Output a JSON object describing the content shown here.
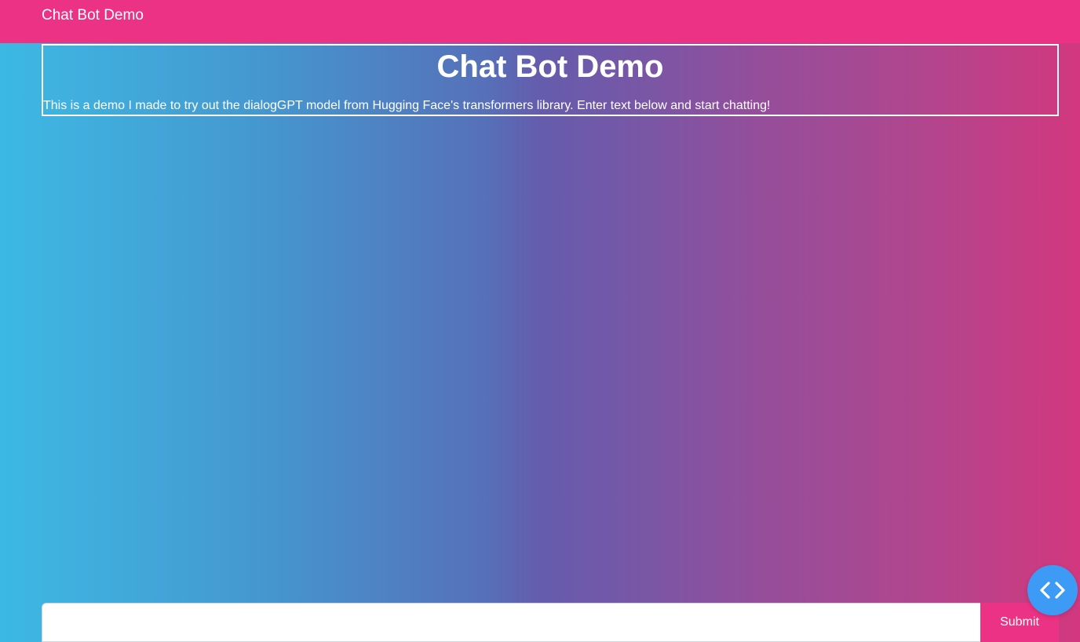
{
  "navbar": {
    "brand": "Chat Bot Demo",
    "background_color": "#eb3284"
  },
  "intro": {
    "title": "Chat Bot Demo",
    "description": "This is a demo I made to try out the dialogGPT model from Hugging Face's transformers library. Enter text below and start chatting!"
  },
  "chat": {
    "messages": []
  },
  "form": {
    "input_value": "",
    "input_placeholder": "",
    "submit_label": "Submit",
    "submit_color": "#eb3284"
  },
  "fab": {
    "icon": "code-icon",
    "color": "#3d9bf5"
  }
}
